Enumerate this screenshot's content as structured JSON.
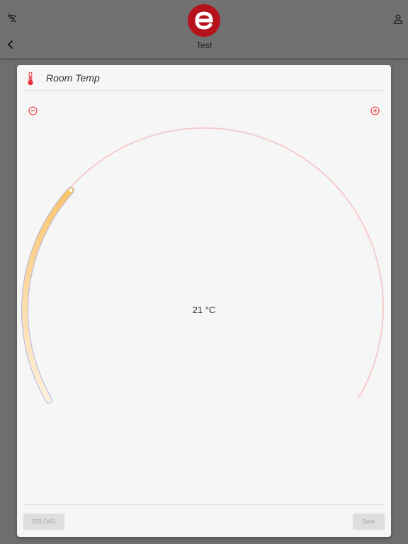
{
  "header": {
    "title": "Test",
    "logo_letter": "e",
    "icons": {
      "left": "wifi-off-icon",
      "right": "user-icon",
      "back": "chevron-left-icon"
    },
    "logo_color": "#b5121b"
  },
  "card": {
    "title": "Room Temp",
    "icon": "thermometer-icon",
    "controls": {
      "decrease": "minus-circle-icon",
      "increase": "plus-circle-icon"
    },
    "accent_color": "#e8363e",
    "gauge": {
      "value_label": "21 °C",
      "fill_fraction": 0.3,
      "fill_color": "#fbc46c",
      "track_color": "#f5cccc",
      "outline_color": "#aeb8e6"
    },
    "buttons": {
      "reload": "RELOAD",
      "save": "Save"
    }
  }
}
